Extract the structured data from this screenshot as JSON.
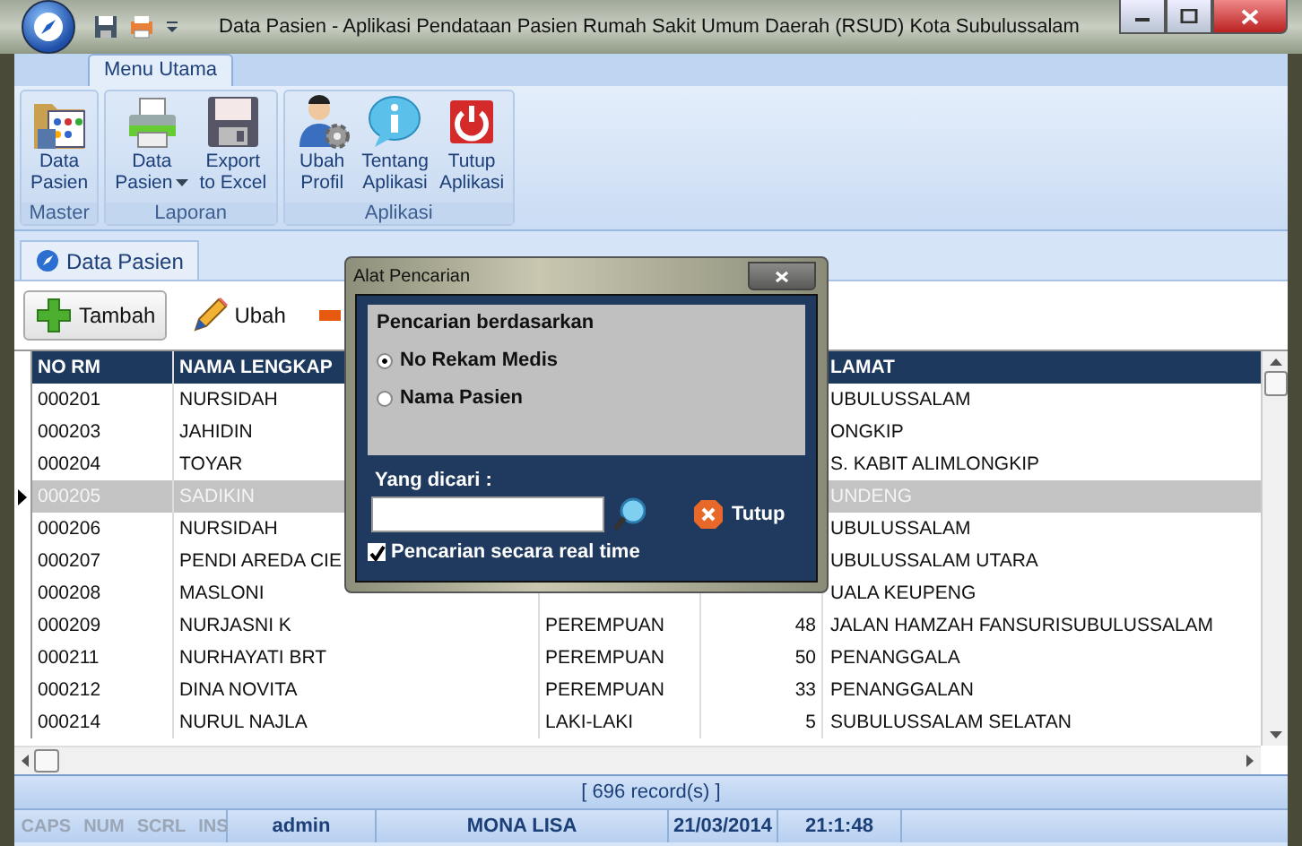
{
  "window": {
    "title": "Data Pasien - Aplikasi Pendataan Pasien Rumah Sakit Umum Daerah (RSUD) Kota Subulussalam"
  },
  "ribbon": {
    "tabs": [
      {
        "label": "Menu Utama",
        "selected": true
      }
    ],
    "groups": [
      {
        "label": "Master",
        "buttons": [
          {
            "kind": "folder",
            "lines": [
              "Data",
              "Pasien"
            ],
            "dropdown": false
          }
        ]
      },
      {
        "label": "Laporan",
        "buttons": [
          {
            "kind": "printer",
            "lines": [
              "Data",
              "Pasien"
            ],
            "dropdown": true
          },
          {
            "kind": "floppy",
            "lines": [
              "Export",
              "to Excel"
            ],
            "dropdown": false
          }
        ]
      },
      {
        "label": "Aplikasi",
        "buttons": [
          {
            "kind": "user",
            "lines": [
              "Ubah",
              "Profil"
            ],
            "dropdown": false
          },
          {
            "kind": "info",
            "lines": [
              "Tentang",
              "Aplikasi"
            ],
            "dropdown": false
          },
          {
            "kind": "power",
            "lines": [
              "Tutup",
              "Aplikasi"
            ],
            "dropdown": false
          }
        ]
      }
    ]
  },
  "document_tabs": [
    {
      "label": "Data Pasien",
      "selected": true
    }
  ],
  "toolbar": [
    {
      "kind": "add",
      "label": "Tambah"
    },
    {
      "kind": "edit",
      "label": "Ubah"
    },
    {
      "kind": "delete"
    }
  ],
  "table": {
    "header": {
      "no_rm": "NO RM",
      "nama_lengkap": "NAMA LENGKAP",
      "alamat": "LAMAT"
    },
    "rows": [
      {
        "no_rm": "000201",
        "nama_lengkap": "NURSIDAH",
        "alamat": "UBULUSSALAM",
        "selected": false
      },
      {
        "no_rm": "000203",
        "nama_lengkap": "JAHIDIN",
        "alamat": "ONGKIP",
        "selected": false
      },
      {
        "no_rm": "000204",
        "nama_lengkap": "TOYAR",
        "alamat": "S. KABIT ALIMLONGKIP",
        "selected": false
      },
      {
        "no_rm": "000205",
        "nama_lengkap": "SADIKIN",
        "alamat": "UNDENG",
        "selected": true
      },
      {
        "no_rm": "000206",
        "nama_lengkap": "NURSIDAH",
        "alamat": "UBULUSSALAM",
        "selected": false
      },
      {
        "no_rm": "000207",
        "nama_lengkap": "PENDI AREDA CIE",
        "alamat": "UBULUSSALAM UTARA",
        "selected": false
      },
      {
        "no_rm": "000208",
        "nama_lengkap": "MASLONI",
        "alamat": "UALA KEUPENG",
        "selected": false
      },
      {
        "no_rm": "000209",
        "nama_lengkap": "NURJASNI K",
        "column_3": "PEREMPUAN",
        "column_4": "48",
        "alamat": "JALAN HAMZAH FANSURISUBULUSSALAM",
        "selected": false
      },
      {
        "no_rm": "000211",
        "nama_lengkap": "NURHAYATI BRT",
        "column_3": "PEREMPUAN",
        "column_4": "50",
        "alamat": "PENANGGALA",
        "selected": false
      },
      {
        "no_rm": "000212",
        "nama_lengkap": "DINA NOVITA",
        "column_3": "PEREMPUAN",
        "column_4": "33",
        "alamat": "PENANGGALAN",
        "selected": false
      },
      {
        "no_rm": "000214",
        "nama_lengkap": "NURUL NAJLA",
        "column_3": "LAKI-LAKI",
        "column_4": "5",
        "alamat": "SUBULUSSALAM SELATAN",
        "selected": false
      }
    ]
  },
  "record_count": "[ 696 record(s) ]",
  "status_bar": {
    "indicators": [
      {
        "label": "CAPS",
        "on": false
      },
      {
        "label": "NUM",
        "on": false
      },
      {
        "label": "SCRL",
        "on": false
      },
      {
        "label": "INS",
        "on": false
      }
    ],
    "fields": [
      "admin",
      "MONA LISA",
      "21/03/2014",
      "21:1:48"
    ]
  },
  "dialog": {
    "title": "Alat Pencarian",
    "group_title": "Pencarian berdasarkan",
    "options": [
      {
        "label": "No Rekam Medis",
        "selected": true
      },
      {
        "label": "Nama Pasien",
        "selected": false
      }
    ],
    "search_label": "Yang dicari :",
    "close_button": "Tutup",
    "realtime": {
      "label": "Pencarian secara real time",
      "checked": true
    }
  }
}
